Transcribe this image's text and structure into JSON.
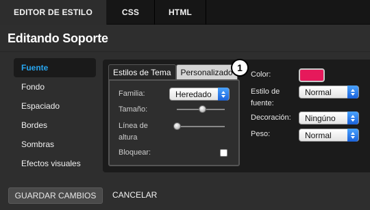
{
  "tabs": [
    "EDITOR DE ESTILO",
    "CSS",
    "HTML"
  ],
  "page_title": "Editando Soporte",
  "nav": {
    "items": [
      "Fuente",
      "Fondo",
      "Espaciado",
      "Bordes",
      "Sombras",
      "Efectos visuales"
    ]
  },
  "subtabs": [
    "Estilos de Tema",
    "Personalizado"
  ],
  "custom": {
    "family_label": "Familia:",
    "family_value": "Heredado",
    "size_label": "Tamaño:",
    "size_level": 0.55,
    "line_height_label": "Línea de altura",
    "line_height_level": 0.0,
    "lock_label": "Bloquear:",
    "lock_checked": false
  },
  "callout": "1",
  "right": {
    "color_label": "Color:",
    "color_value": "#e6195b",
    "font_style_label": "Estilo de fuente:",
    "font_style_value": "Normal",
    "decoration_label": "Decoración:",
    "decoration_value": "Ningúno",
    "weight_label": "Peso:",
    "weight_value": "Normal"
  },
  "footer": {
    "save_label": "GUARDAR CAMBIOS",
    "cancel_label": "CANCELAR"
  },
  "colors": {
    "accent_blue": "#28a6f0",
    "swatch_pink": "#e6195b",
    "panel_bg": "#1b1b1b"
  }
}
